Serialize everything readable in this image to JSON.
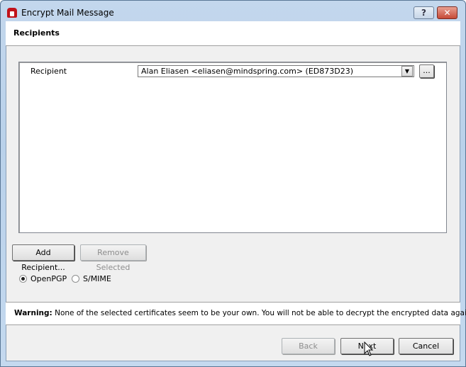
{
  "window": {
    "title": "Encrypt Mail Message",
    "help_label": "?",
    "close_label": "✕"
  },
  "header": {
    "title": "Recipients"
  },
  "recipients": {
    "label": "Recipient",
    "selected": "Alan Eliasen <eliasen@mindspring.com> (ED873D23)",
    "browse_label": "...",
    "dropdown_icon": "▼"
  },
  "actions": {
    "add": "Add Recipient...",
    "remove": "Remove Selected"
  },
  "protocol": {
    "options": [
      "OpenPGP",
      "S/MIME"
    ],
    "selected": "OpenPGP"
  },
  "warning": {
    "label": "Warning:",
    "text": " None of the selected certificates seem to be your own. You will not be able to decrypt the encrypted data again."
  },
  "footer": {
    "back": "Back",
    "next": "Next",
    "cancel": "Cancel"
  }
}
